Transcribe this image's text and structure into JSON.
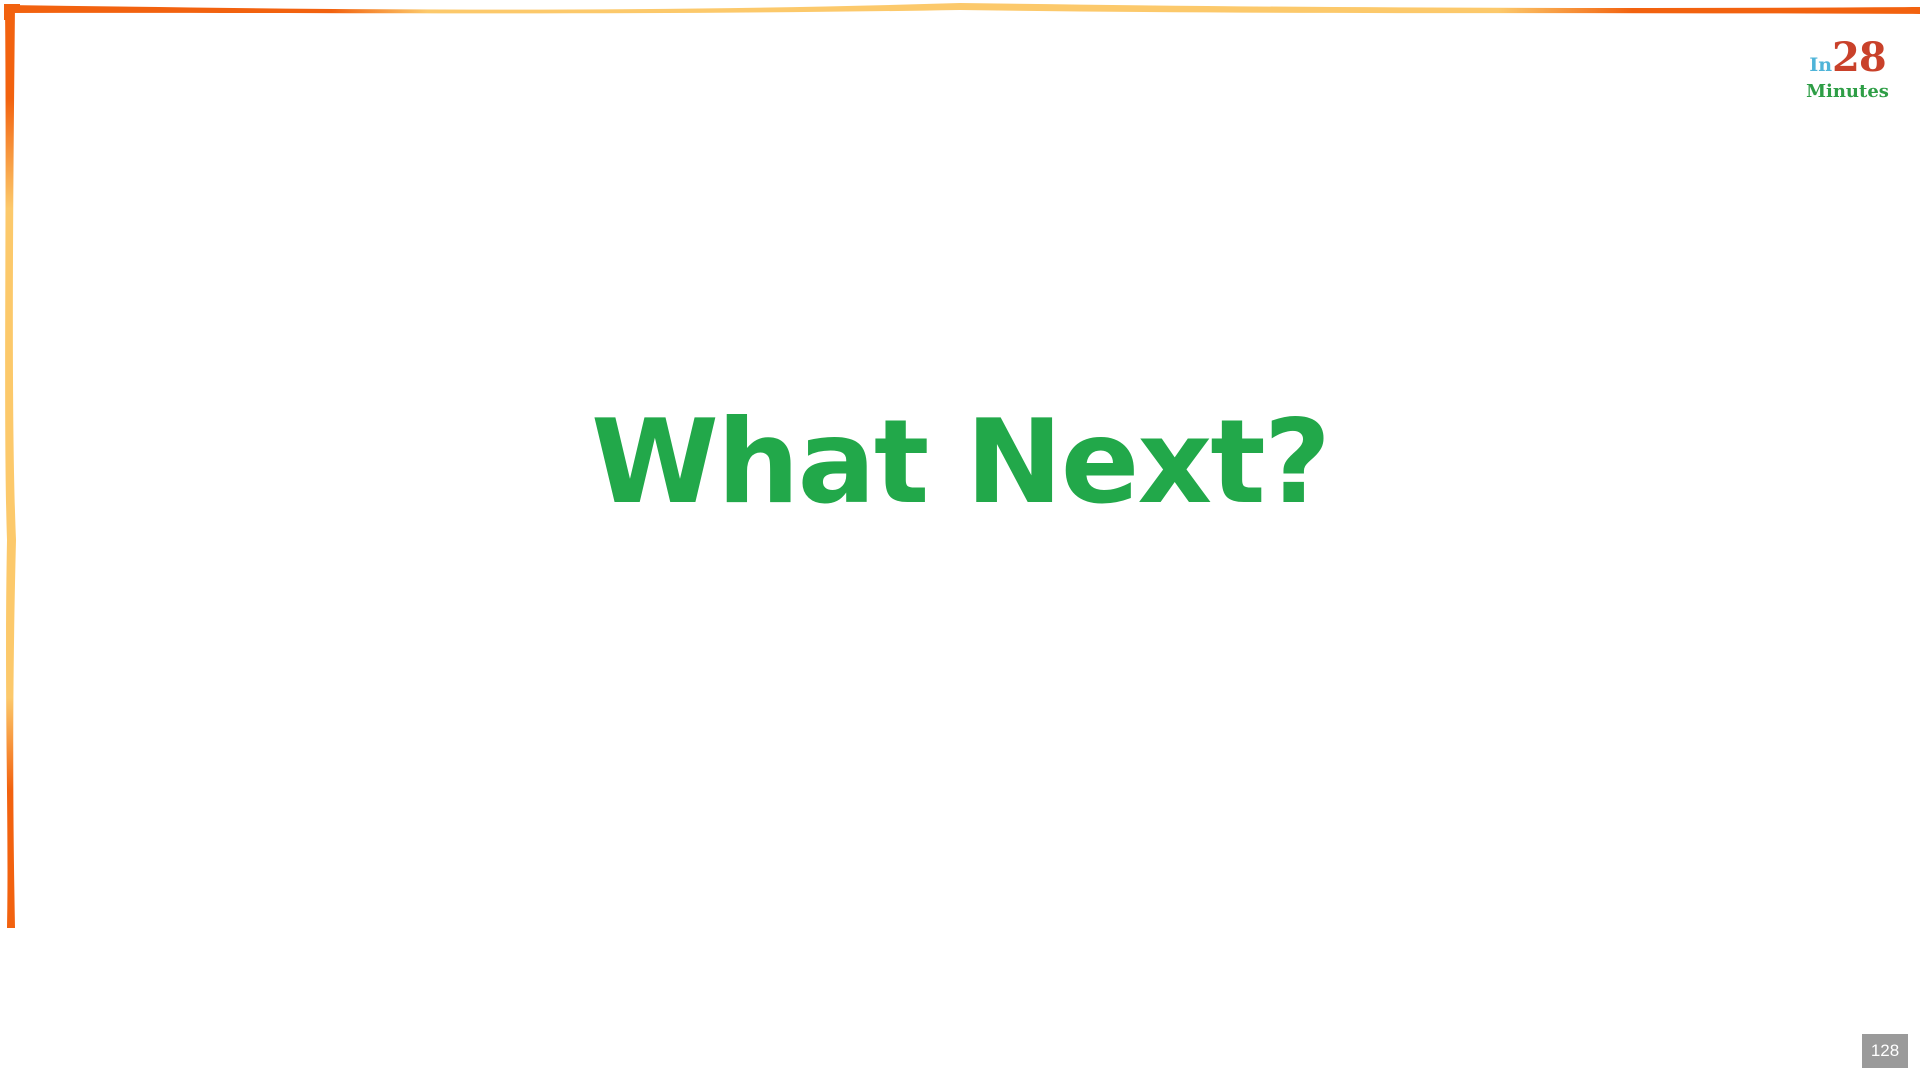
{
  "slide": {
    "title": "What Next?",
    "page_number": "128"
  },
  "logo": {
    "prefix": "In",
    "number": "28",
    "suffix": "Minutes"
  },
  "colors": {
    "title": "#22a84a",
    "border_orange": "#f2620f",
    "border_yellow": "#fcc96b",
    "logo_in": "#4fb4d8",
    "logo_number": "#c9412a",
    "logo_minutes": "#2e9e46",
    "page_badge": "#9a9a9a"
  }
}
